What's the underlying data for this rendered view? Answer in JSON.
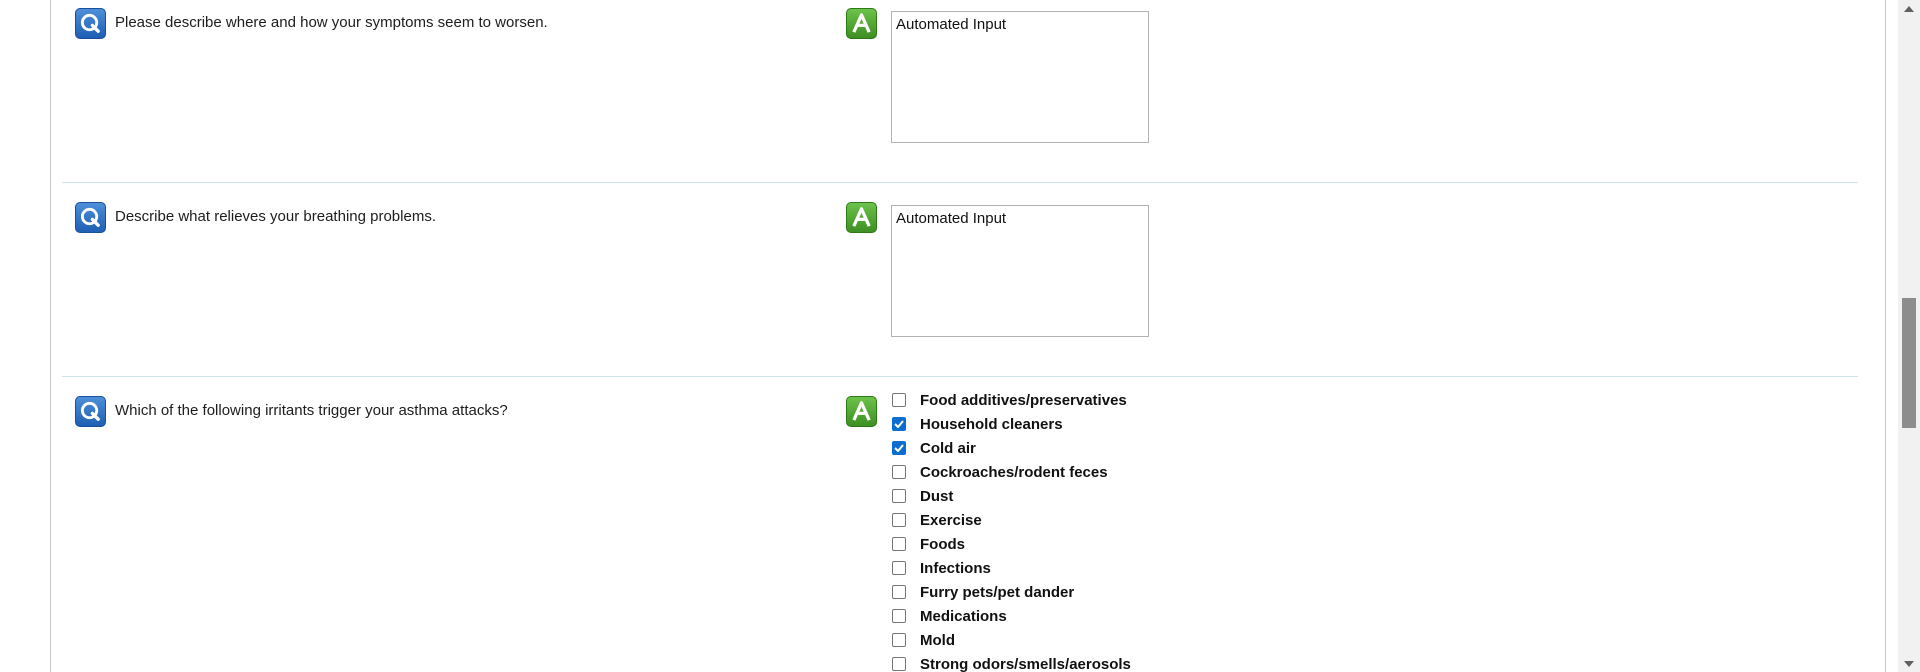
{
  "questions": [
    {
      "question": "Please describe where and how your symptoms seem to worsen.",
      "answer": "Automated Input"
    },
    {
      "question": "Describe what relieves your breathing problems.",
      "answer": "Automated Input"
    },
    {
      "question": "Which of the following irritants trigger your asthma attacks?",
      "options": [
        {
          "label": "Food additives/preservatives",
          "checked": false
        },
        {
          "label": "Household cleaners",
          "checked": true
        },
        {
          "label": "Cold air",
          "checked": true
        },
        {
          "label": "Cockroaches/rodent feces",
          "checked": false
        },
        {
          "label": "Dust",
          "checked": false
        },
        {
          "label": "Exercise",
          "checked": false
        },
        {
          "label": "Foods",
          "checked": false
        },
        {
          "label": "Infections",
          "checked": false
        },
        {
          "label": "Furry pets/pet dander",
          "checked": false
        },
        {
          "label": "Medications",
          "checked": false
        },
        {
          "label": "Mold",
          "checked": false
        },
        {
          "label": "Strong odors/smells/aerosols",
          "checked": false
        }
      ]
    }
  ],
  "icons": {
    "question_icon": "q-icon",
    "answer_icon": "a-icon"
  },
  "colors": {
    "question_icon": "#1f5fb4",
    "answer_icon": "#3d8f22",
    "checkbox_checked": "#0a6ed1",
    "separator": "#cfe3ea"
  }
}
